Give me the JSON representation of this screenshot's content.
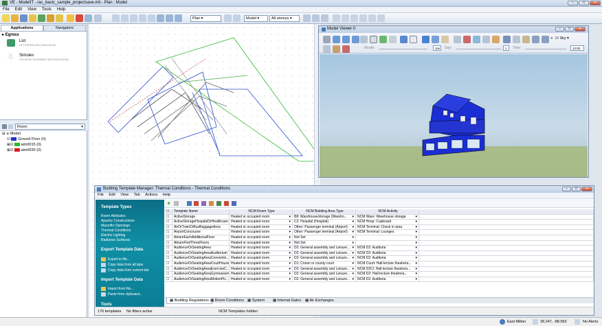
{
  "window": {
    "title": "VE - ModelIT - rac_basic_sample_projectsave.mit - Plan : Model"
  },
  "menu": [
    "File",
    "Edit",
    "View",
    "Tools",
    "Help"
  ],
  "toolbar": {
    "view_select": "Plan",
    "model_select": "Model",
    "storeys_select": "All storeys"
  },
  "left": {
    "tabs": [
      "Applications",
      "Navigators"
    ],
    "section": "Egress",
    "apps": [
      {
        "name": "List",
        "desc": "LIFT EGRESS (EG) SIMULATION"
      },
      {
        "name": "Simulex",
        "desc": "OCCUPANT MOVEMENT AND EVACUATION"
      }
    ],
    "room_select": "Room",
    "tree_root": "Model",
    "tree_items": [
      {
        "label": "Ground Floor (0)",
        "color": "#1f33c8"
      },
      {
        "label": "aim0015 (0)",
        "color": "#2cb82c"
      },
      {
        "label": "aim0030 (0)",
        "color": "#d81c1c"
      }
    ]
  },
  "viewer": {
    "title": "Model Viewer II",
    "sky_label": "Sky",
    "month_label": "Month:",
    "month_value": "Jan",
    "day_label": "Day:",
    "day_value": "1",
    "time_label": "Time:",
    "time_value": "12:00"
  },
  "manager": {
    "title": "Building Template Manager: Thermal Conditions - Thermal Conditions",
    "menu": [
      "File",
      "Edit",
      "View",
      "Tab",
      "Actions",
      "Help"
    ],
    "side_header": "Template Types",
    "side_items": [
      "Room Attributes",
      "Apache Constructions",
      "Macroflo Openings",
      "Thermal Conditions",
      "Electric Lighting",
      "Radiance Surfaces"
    ],
    "export_header": "Export Template Data",
    "export_items": [
      "Export to file...",
      "Copy data from all tabs",
      "Copy data from current tab"
    ],
    "import_header": "Import Template Data",
    "import_items": [
      "Import from file...",
      "Paste from clipboard..."
    ],
    "tools_header": "Tools",
    "columns": [
      "Template Name",
      "NCM Room Type",
      "NCM Building Area Type",
      "NCM Activity"
    ],
    "rows": [
      [
        "ActiveStorage",
        "Heated or occupied room",
        "B8: Warehouse/storage (Wareho...",
        "NCM Ware: Warehouse storage"
      ],
      [
        "ActiveStorageHospitalOrHealthcare",
        "Heated or occupied room",
        "C2: Hospital (Hospital)",
        "NCM Hosp: Cupboard"
      ],
      [
        "AirOrTrainOrBusBaggageArea",
        "Heated or occupied room",
        "Other: Passenger terminal (Airport)",
        "NCM Terminal: Check in area"
      ],
      [
        "AirportConcourse",
        "Heated or occupied room",
        "Other: Passenger terminal (Airport)",
        "NCM Terminal: Lounges"
      ],
      [
        "AtriumEachAdditionalFloor",
        "Heated or occupied room",
        "Not Set",
        ""
      ],
      [
        "AtriumFirstThreeFloors",
        "Heated or occupied room",
        "Not Set",
        ""
      ],
      [
        "AudienceOrSeatingArea",
        "Heated or occupied room",
        "D2: General assembly and Leisure...",
        "NCM D2: Auditoria"
      ],
      [
        "AudienceOrSeatingAreaAuditorium",
        "Heated or occupied room",
        "D2: General assembly and Leisure...",
        "NCM D2: Auditoria"
      ],
      [
        "AudienceOrSeatingAreaConventio...",
        "Heated or occupied room",
        "D2: General assembly and Leisure...",
        "NCM D2: Auditoria"
      ],
      [
        "AudienceOrSeatingAreaCourtHouse",
        "Heated or occupied room",
        "D1: Crown or county court",
        "NCM Court: Hall-lecture theatre/a..."
      ],
      [
        "AudienceOrSeatingAreaExerciseC...",
        "Heated or occupied room",
        "D2: General assembly and Leisure...",
        "NCM D2Cl: Hall-lecture theatre/a..."
      ],
      [
        "AudienceOrSeatingAreaGymnasium",
        "Heated or occupied room",
        "D2: General assembly and Leisure...",
        "NCM D2: Hall-lecture theatre/a..."
      ],
      [
        "AudienceOrSeatingAreaMotionPic...",
        "Heated or occupied room",
        "D2: General assembly and Leisure...",
        "NCM D2: Auditoria"
      ]
    ],
    "bottom_tabs": [
      "Building Regulations",
      "Room Conditions",
      "System",
      "Internal Gains",
      "Air Exchanges"
    ],
    "status": [
      "176 templates",
      "No filters active",
      "NCM Templates hidden"
    ]
  },
  "statusbar": {
    "location": "East Milton",
    "coords": "28.247, -88.583",
    "alerts": "No Alerts"
  }
}
